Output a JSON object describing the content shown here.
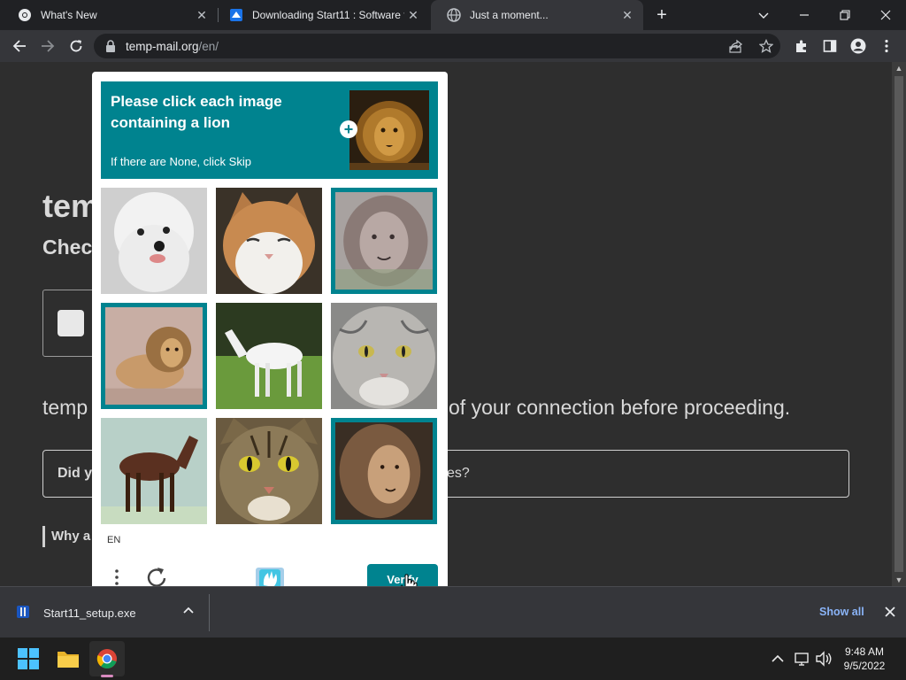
{
  "tabs": [
    {
      "title": "What's New",
      "favicon": "chrome-icon",
      "active": false
    },
    {
      "title": "Downloading Start11 : Software f",
      "favicon": "stardock-icon",
      "active": false
    },
    {
      "title": "Just a moment...",
      "favicon": "globe-icon",
      "active": true
    }
  ],
  "address_bar": {
    "domain": "temp-mail.org",
    "path": "/en/"
  },
  "page": {
    "heading": "tem",
    "subheading": "Chec",
    "line_left": "temp",
    "line_right": "of your connection before proceeding.",
    "details_left": "Did y",
    "details_right": "ites?",
    "why": "Why a"
  },
  "captcha": {
    "prompt": "Please click each image containing a lion",
    "subtext": "If there are None, click Skip",
    "language": "EN",
    "verify_label": "Verify",
    "accent_color": "#00838f",
    "tiles": [
      {
        "subject": "dog",
        "selected": false
      },
      {
        "subject": "cat",
        "selected": false
      },
      {
        "subject": "lion",
        "selected": true
      },
      {
        "subject": "lion",
        "selected": true
      },
      {
        "subject": "horse",
        "selected": false
      },
      {
        "subject": "cat",
        "selected": false
      },
      {
        "subject": "horse",
        "selected": false
      },
      {
        "subject": "cat",
        "selected": false
      },
      {
        "subject": "lion",
        "selected": true
      }
    ]
  },
  "download_shelf": {
    "filename": "Start11_setup.exe",
    "show_all_label": "Show all"
  },
  "taskbar": {
    "time": "9:48 AM",
    "date": "9/5/2022"
  }
}
